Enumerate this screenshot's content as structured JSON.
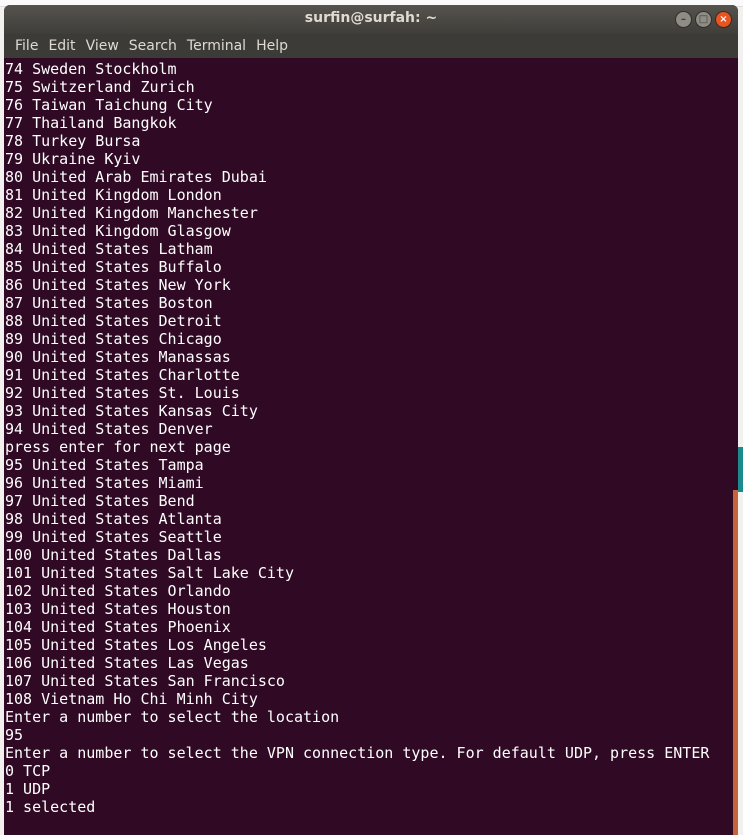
{
  "window": {
    "title": "surfin@surfah: ~",
    "buttons": [
      "minimize",
      "maximize",
      "close"
    ]
  },
  "menu": [
    "File",
    "Edit",
    "View",
    "Search",
    "Terminal",
    "Help"
  ],
  "terminal_lines": [
    "74 Sweden Stockholm",
    "75 Switzerland Zurich",
    "76 Taiwan Taichung City",
    "77 Thailand Bangkok",
    "78 Turkey Bursa",
    "79 Ukraine Kyiv",
    "80 United Arab Emirates Dubai",
    "81 United Kingdom London",
    "82 United Kingdom Manchester",
    "83 United Kingdom Glasgow",
    "84 United States Latham",
    "85 United States Buffalo",
    "86 United States New York",
    "87 United States Boston",
    "88 United States Detroit",
    "89 United States Chicago",
    "90 United States Manassas",
    "91 United States Charlotte",
    "92 United States St. Louis",
    "93 United States Kansas City",
    "94 United States Denver",
    "press enter for next page",
    "95 United States Tampa",
    "96 United States Miami",
    "97 United States Bend",
    "98 United States Atlanta",
    "99 United States Seattle",
    "100 United States Dallas",
    "101 United States Salt Lake City",
    "102 United States Orlando",
    "103 United States Houston",
    "104 United States Phoenix",
    "105 United States Los Angeles",
    "106 United States Las Vegas",
    "107 United States San Francisco",
    "108 Vietnam Ho Chi Minh City",
    "Enter a number to select the location",
    "95",
    "Enter a number to select the VPN connection type. For default UDP, press ENTER",
    "0 TCP",
    "1 UDP",
    "1 selected"
  ],
  "colors": {
    "terminal_bg": "#300a24",
    "text": "#ffffff",
    "close_button": "#e95420"
  }
}
